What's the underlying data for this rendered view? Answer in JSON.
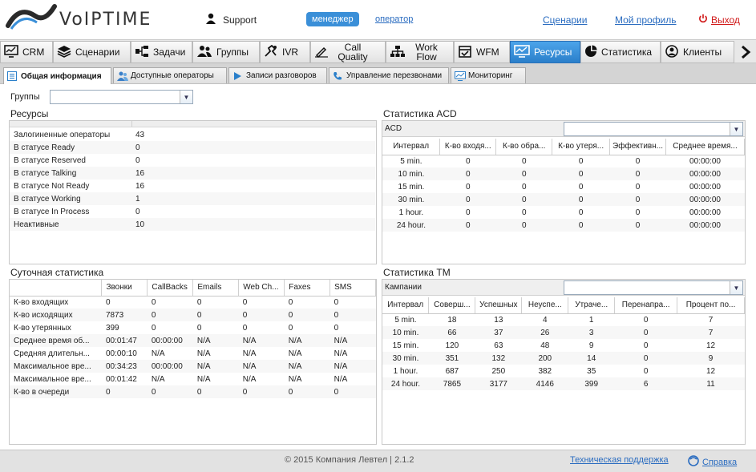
{
  "header": {
    "logo_text": "VoIPTIME",
    "user_name": "Support",
    "role_active": "менеджер",
    "role_other": "оператор",
    "links": {
      "scenarios": "Сценарии",
      "profile": "Мой профиль",
      "exit": "Выход"
    }
  },
  "nav": {
    "items": [
      {
        "label": "CRM",
        "icon": "monitor-chart-icon"
      },
      {
        "label": "Сценарии",
        "icon": "layers-icon"
      },
      {
        "label": "Задачи",
        "icon": "task-tree-icon"
      },
      {
        "label": "Группы",
        "icon": "users-icon"
      },
      {
        "label": "IVR",
        "icon": "ivr-icon"
      },
      {
        "label": "Call Quality",
        "icon": "pen-icon"
      },
      {
        "label": "Work Flow",
        "icon": "workflow-icon"
      },
      {
        "label": "WFM",
        "icon": "calendar-check-icon"
      },
      {
        "label": "Ресурсы",
        "icon": "resources-monitor-icon"
      },
      {
        "label": "Статистика",
        "icon": "pie-chart-icon"
      },
      {
        "label": "Клиенты",
        "icon": "client-icon"
      }
    ],
    "active": "Ресурсы"
  },
  "subtabs": [
    {
      "label": "Общая информация",
      "icon": "list-icon"
    },
    {
      "label": "Доступные операторы",
      "icon": "operators-icon"
    },
    {
      "label": "Записи разговоров",
      "icon": "play-icon"
    },
    {
      "label": "Управление перезвонами",
      "icon": "phone-icon"
    },
    {
      "label": "Мониторинг",
      "icon": "monitor-icon"
    }
  ],
  "filters": {
    "groups_label": "Группы",
    "groups_value": ""
  },
  "resources": {
    "title": "Ресурсы",
    "rows": [
      {
        "label": "Залогиненные операторы",
        "value": "43"
      },
      {
        "label": "В статусе Ready",
        "value": "0"
      },
      {
        "label": "В статусе Reserved",
        "value": "0"
      },
      {
        "label": "В статусе Talking",
        "value": "16"
      },
      {
        "label": "В статусе Not Ready",
        "value": "16"
      },
      {
        "label": "В статусе Working",
        "value": "1"
      },
      {
        "label": "В статусе In Process",
        "value": "0"
      },
      {
        "label": "Неактивные",
        "value": "10"
      }
    ]
  },
  "acd": {
    "title": "Статистика ACD",
    "filter_label": "ACD",
    "filter_value": "",
    "columns": [
      "Интервал",
      "К-во входя...",
      "К-во обра...",
      "К-во утеря...",
      "Эффективн...",
      "Среднее время..."
    ],
    "rows": [
      [
        "5 min.",
        "0",
        "0",
        "0",
        "0",
        "00:00:00"
      ],
      [
        "10 min.",
        "0",
        "0",
        "0",
        "0",
        "00:00:00"
      ],
      [
        "15 min.",
        "0",
        "0",
        "0",
        "0",
        "00:00:00"
      ],
      [
        "30 min.",
        "0",
        "0",
        "0",
        "0",
        "00:00:00"
      ],
      [
        "1 hour.",
        "0",
        "0",
        "0",
        "0",
        "00:00:00"
      ],
      [
        "24 hour.",
        "0",
        "0",
        "0",
        "0",
        "00:00:00"
      ]
    ]
  },
  "daily": {
    "title": "Суточная статистика",
    "columns": [
      "",
      "Звонки",
      "CallBacks",
      "Emails",
      "Web Ch...",
      "Faxes",
      "SMS"
    ],
    "rows": [
      [
        "К-во входящих",
        "0",
        "0",
        "0",
        "0",
        "0",
        "0"
      ],
      [
        "К-во исходящих",
        "7873",
        "0",
        "0",
        "0",
        "0",
        "0"
      ],
      [
        "К-во утерянных",
        "399",
        "0",
        "0",
        "0",
        "0",
        "0"
      ],
      [
        "Среднее время об...",
        "00:01:47",
        "00:00:00",
        "N/A",
        "N/A",
        "N/A",
        "N/A"
      ],
      [
        "Средняя длительн...",
        "00:00:10",
        "N/A",
        "N/A",
        "N/A",
        "N/A",
        "N/A"
      ],
      [
        "Максимальное вре...",
        "00:34:23",
        "00:00:00",
        "N/A",
        "N/A",
        "N/A",
        "N/A"
      ],
      [
        "Максимальное вре...",
        "00:01:42",
        "N/A",
        "N/A",
        "N/A",
        "N/A",
        "N/A"
      ],
      [
        "К-во в очереди",
        "0",
        "0",
        "0",
        "0",
        "0",
        "0"
      ]
    ]
  },
  "tm": {
    "title": "Статистика ТМ",
    "filter_label": "Кампании",
    "filter_value": "",
    "columns": [
      "Интервал",
      "Соверш...",
      "Успешных",
      "Неуспе...",
      "Утраче...",
      "Перенапра...",
      "Процент по..."
    ],
    "rows": [
      [
        "5 min.",
        "18",
        "13",
        "4",
        "1",
        "0",
        "7"
      ],
      [
        "10 min.",
        "66",
        "37",
        "26",
        "3",
        "0",
        "7"
      ],
      [
        "15 min.",
        "120",
        "63",
        "48",
        "9",
        "0",
        "12"
      ],
      [
        "30 min.",
        "351",
        "132",
        "200",
        "14",
        "0",
        "9"
      ],
      [
        "1 hour.",
        "687",
        "250",
        "382",
        "35",
        "0",
        "12"
      ],
      [
        "24 hour.",
        "7865",
        "3177",
        "4146",
        "399",
        "6",
        "11"
      ]
    ]
  },
  "footer": {
    "copyright": "© 2015 Компания Левтел | 2.1.2",
    "support": "Техническая поддержка",
    "help": "Справка"
  },
  "colors": {
    "accent": "#3a8fd8",
    "exit": "#d01818",
    "link": "#2a6cc0"
  }
}
